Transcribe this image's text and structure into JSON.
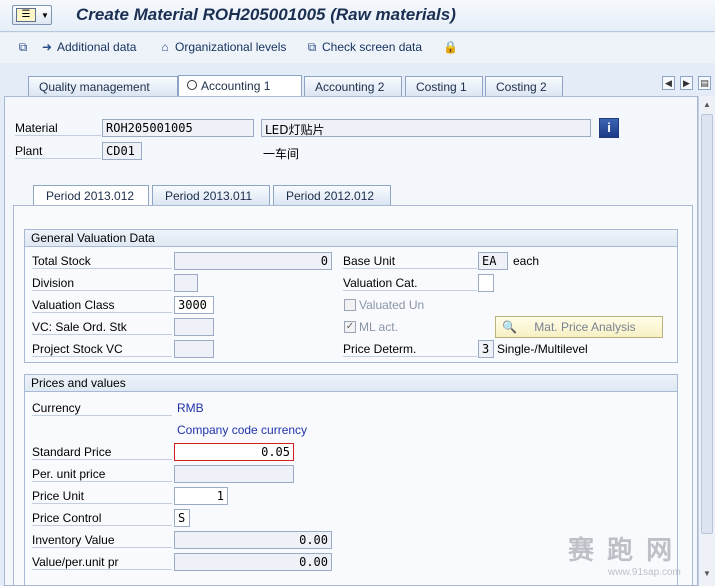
{
  "window": {
    "title": "Create Material ROH205001005 (Raw materials)"
  },
  "toolbar": {
    "additional_data": "Additional data",
    "org_levels": "Organizational levels",
    "check_screen": "Check screen data"
  },
  "main_tabs": [
    "Quality management",
    "Accounting 1",
    "Accounting 2",
    "Costing 1",
    "Costing 2"
  ],
  "header": {
    "material_label": "Material",
    "material_value": "ROH205001005",
    "material_desc": "LED灯贴片",
    "plant_label": "Plant",
    "plant_value": "CD01",
    "plant_desc": "一车间"
  },
  "period_tabs": [
    "Period 2013.012",
    "Period 2013.011",
    "Period 2012.012"
  ],
  "general": {
    "title": "General Valuation Data",
    "total_stock_label": "Total Stock",
    "total_stock_value": "0",
    "base_unit_label": "Base Unit",
    "base_unit_value": "EA",
    "base_unit_text": "each",
    "division_label": "Division",
    "division_value": "",
    "valuation_cat_label": "Valuation Cat.",
    "valuation_cat_value": "",
    "valuation_class_label": "Valuation Class",
    "valuation_class_value": "3000",
    "valuated_un_label": "Valuated Un",
    "valuated_un_checked": false,
    "vc_sale_label": "VC: Sale Ord. Stk",
    "ml_act_label": "ML act.",
    "ml_act_checked": true,
    "mat_price_analysis": "Mat. Price Analysis",
    "project_stock_label": "Project Stock VC",
    "price_determ_label": "Price Determ.",
    "price_determ_value": "3",
    "price_determ_text": "Single-/Multilevel"
  },
  "prices": {
    "title": "Prices and values",
    "currency_label": "Currency",
    "currency_value": "RMB",
    "currency_note": "Company code currency",
    "standard_price_label": "Standard Price",
    "standard_price_value": "0.05",
    "per_unit_label": "Per. unit price",
    "per_unit_value": "",
    "price_unit_label": "Price Unit",
    "price_unit_value": "1",
    "price_control_label": "Price Control",
    "price_control_value": "S",
    "inventory_label": "Inventory Value",
    "inventory_value": "0.00",
    "value_per_unit_label": "Value/per.unit pr",
    "value_per_unit_value": "0.00"
  },
  "watermark": {
    "text": "赛 跑 网",
    "url": "www.91sap.com"
  }
}
